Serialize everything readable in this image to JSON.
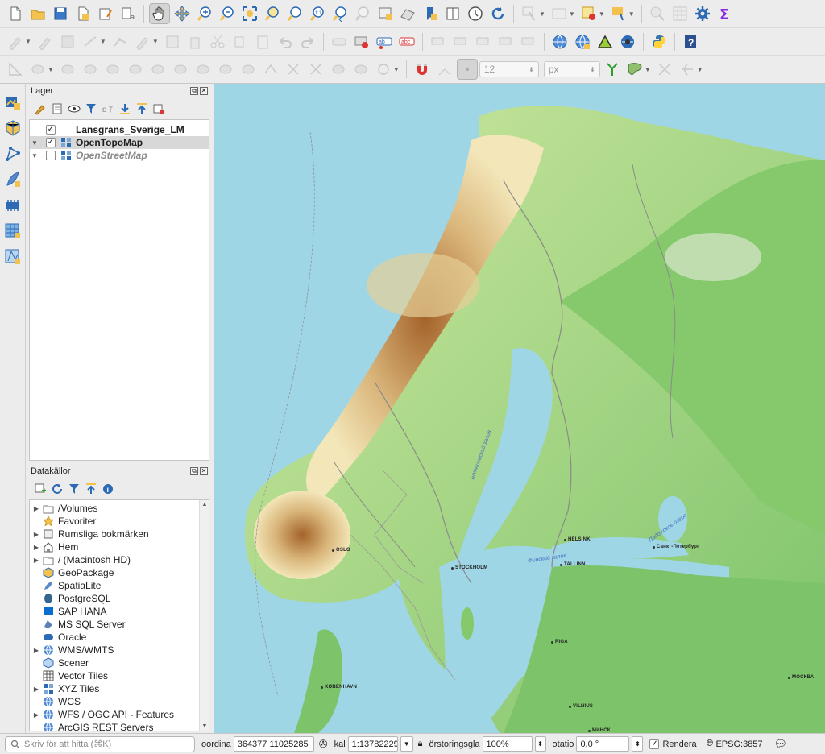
{
  "toolbar": {
    "scale_size_value": "12",
    "unit_value": "px"
  },
  "layers_panel": {
    "title": "Lager",
    "layers": [
      {
        "name": "Lansgrans_Sverige_LM",
        "checked": true,
        "selected": false,
        "italic": false
      },
      {
        "name": "OpenTopoMap",
        "checked": true,
        "selected": true,
        "italic": false
      },
      {
        "name": "OpenStreetMap",
        "checked": false,
        "selected": false,
        "italic": true
      }
    ]
  },
  "sources_panel": {
    "title": "Datakällor",
    "items": [
      {
        "label": "/Volumes",
        "icon": "folder-icon",
        "expandable": true
      },
      {
        "label": "Favoriter",
        "icon": "star-icon",
        "expandable": false
      },
      {
        "label": "Rumsliga bokmärken",
        "icon": "bookmark-icon",
        "expandable": true
      },
      {
        "label": "Hem",
        "icon": "home-icon",
        "expandable": true
      },
      {
        "label": "/ (Macintosh HD)",
        "icon": "folder-icon",
        "expandable": true
      },
      {
        "label": "GeoPackage",
        "icon": "geopackage-icon",
        "expandable": false
      },
      {
        "label": "SpatiaLite",
        "icon": "spatialite-icon",
        "expandable": false
      },
      {
        "label": "PostgreSQL",
        "icon": "postgresql-icon",
        "expandable": false
      },
      {
        "label": "SAP HANA",
        "icon": "sap-hana-icon",
        "expandable": false
      },
      {
        "label": "MS SQL Server",
        "icon": "mssql-icon",
        "expandable": false
      },
      {
        "label": "Oracle",
        "icon": "oracle-icon",
        "expandable": false
      },
      {
        "label": "WMS/WMTS",
        "icon": "globe-icon",
        "expandable": true
      },
      {
        "label": "Scener",
        "icon": "cube-icon",
        "expandable": false
      },
      {
        "label": "Vector Tiles",
        "icon": "grid-icon",
        "expandable": false
      },
      {
        "label": "XYZ Tiles",
        "icon": "tiles-icon",
        "expandable": true
      },
      {
        "label": "WCS",
        "icon": "globe-icon",
        "expandable": false
      },
      {
        "label": "WFS / OGC API - Features",
        "icon": "globe-icon",
        "expandable": true
      },
      {
        "label": "ArcGIS REST Servers",
        "icon": "globe-icon",
        "expandable": false
      }
    ]
  },
  "map": {
    "cities": [
      {
        "name": "OSLO"
      },
      {
        "name": "STOCKHOLM"
      },
      {
        "name": "HELSINKI"
      },
      {
        "name": "TALLINN"
      },
      {
        "name": "RIGA"
      },
      {
        "name": "KØBENHAVN"
      },
      {
        "name": "VILNIUS"
      },
      {
        "name": "Санкт-Петербург"
      },
      {
        "name": "МОСКВА"
      },
      {
        "name": "МИНСК"
      }
    ],
    "seas": [
      {
        "name": "Бoтнический залив"
      },
      {
        "name": "Финский залив"
      },
      {
        "name": "Ладожское озеро"
      }
    ]
  },
  "statusbar": {
    "locator_placeholder": "Skriv för att hitta (⌘K)",
    "coordinate_label": "oordina",
    "coordinate_value": "364377  11025285",
    "scale_label": "kal",
    "scale_value": "1:13782229",
    "magnifier_label": "örstoringsgla",
    "magnifier_value": "100%",
    "rotation_label": "otatio",
    "rotation_value": "0,0 °",
    "render_label": "Rendera",
    "crs_label": "EPSG:3857"
  }
}
